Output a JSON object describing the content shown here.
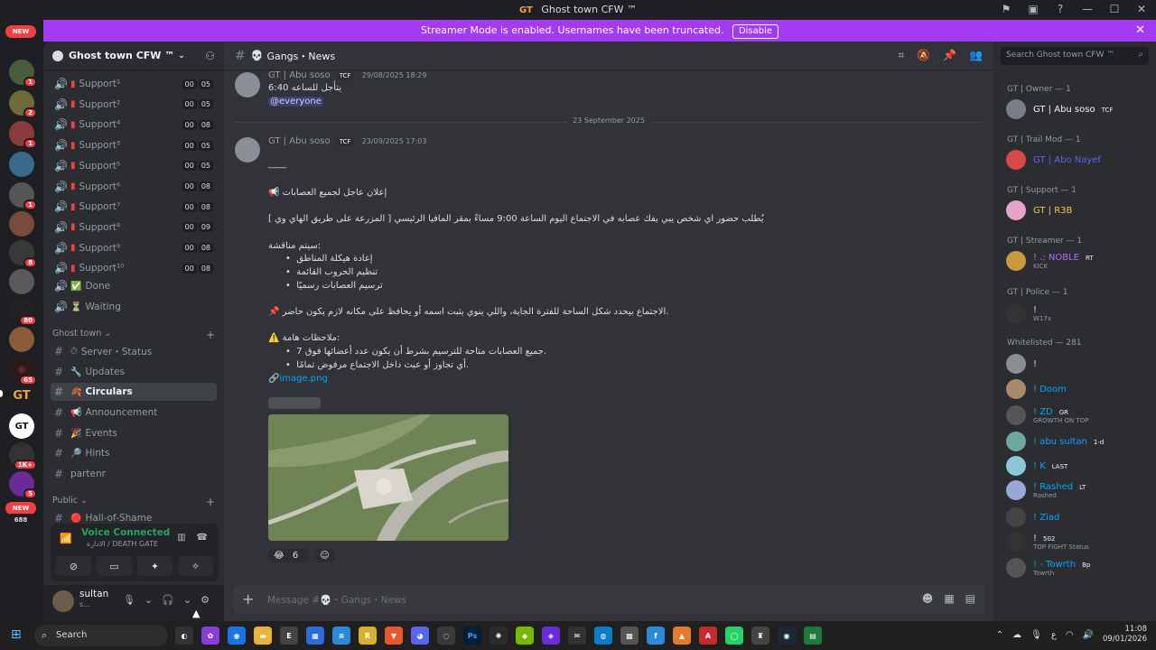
{
  "window": {
    "app_badge": "GT",
    "title": "Ghost town CFW ™",
    "minimize": "—",
    "maximize": "☐",
    "close": "✕"
  },
  "banner": {
    "text": "Streamer Mode is enabled. Usernames have been truncated.",
    "button": "Disable"
  },
  "server_rail": {
    "badges": [
      "1",
      "1",
      "2",
      "1",
      "1",
      "1",
      "8",
      "80",
      "65",
      "1K+",
      "5",
      "688"
    ],
    "new_label": "NEW"
  },
  "sidebar": {
    "guild_name": "Ghost town CFW ™",
    "channels": [
      {
        "name": "Support¹",
        "a": "00",
        "b": "05"
      },
      {
        "name": "Support²",
        "a": "00",
        "b": "05"
      },
      {
        "name": "Support⁴",
        "a": "00",
        "b": "08"
      },
      {
        "name": "Support³",
        "a": "00",
        "b": "05"
      },
      {
        "name": "Support⁵",
        "a": "00",
        "b": "05"
      },
      {
        "name": "Support⁶",
        "a": "00",
        "b": "08"
      },
      {
        "name": "Support⁷",
        "a": "00",
        "b": "08"
      },
      {
        "name": "Support⁸",
        "a": "00",
        "b": "09"
      },
      {
        "name": "Support⁹",
        "a": "00",
        "b": "08"
      },
      {
        "name": "Support¹⁰",
        "a": "00",
        "b": "08"
      }
    ],
    "done": "Done",
    "waiting": "Waiting",
    "cat_ghost": "Ghost town",
    "server_status": "Server・Status",
    "updates": "Updates",
    "circulars": "Circulars",
    "announcement": "Announcement",
    "events": "Events",
    "hints": "Hints",
    "partner": "partenr",
    "cat_public": "Public",
    "hall": "Hall-of-Shame"
  },
  "voice": {
    "status": "Voice Connected",
    "channel": "الادارة / DEATH GATE"
  },
  "user": {
    "name": "sultan",
    "status": "s..."
  },
  "channel_header": {
    "name": "Gangs・News"
  },
  "messages": {
    "m1_author": "GT | Abu soso",
    "m1_tag": "TCF",
    "m1_time": "29/08/2025 18:29",
    "m1_line1": "يتأجل للساعه 6:40",
    "m1_mention": "@everyone",
    "date_divider": "23 September 2025",
    "m2_author": "GT | Abu soso",
    "m2_tag": "TCF",
    "m2_time": "23/09/2025 17:03",
    "l_sep": "____",
    "l1": "📢 إعلان عاجل لجميع العصابات",
    "l2": "يُطلب حضور اي شخص يبي يفك عصابه في الاجتماع اليوم الساعة 9:00 مساءً بمقر المافيا الرئيسي [ المزرعة على طريق الهاي وي ]",
    "l3": "سيتم مناقشة:",
    "b1": "إعادة هيكلة المناطق",
    "b2": "تنظيم الحروب القائمة",
    "b3": "ترسيم العصابات رسميًا",
    "l4": "📌 الاجتماع بيحدد شكل الساحة للفترة الجاية، واللي ينوي يثبت اسمه أو يحافظ على مكانه لازم يكون حاضر.",
    "l5": "⚠️ ملاحظات هامة:",
    "b4": "جميع العصابات متاحة للترسيم بشرط أن يكون عدد أعضائها فوق 7.",
    "b5": "أي تجاوز أو عبث داخل الاجتماع مرفوض تمامًا.",
    "attachment": "image.png",
    "reaction_count": "6"
  },
  "composer": {
    "placeholder": "Message #💀・Gangs・News"
  },
  "members": {
    "search_placeholder": "Search Ghost town CFW ™",
    "groups": {
      "owner": "GT | Owner — 1",
      "trail": "GT | Trail Mod — 1",
      "support": "GT | Support — 1",
      "streamer": "GT | Streamer — 1",
      "police": "GT | Police — 1",
      "white": "Whitelisted — 281"
    },
    "list": [
      {
        "name": "GT | Abu soso",
        "sub": "",
        "tag": "TCF",
        "color": "#f2f3f5"
      },
      {
        "name": "GT | Abo Nayef",
        "sub": "",
        "tag": "",
        "color": "#5865f2"
      },
      {
        "name": "GT | R3B",
        "sub": "",
        "tag": "",
        "color": "#f2c94c"
      },
      {
        "name": "! .: NOBLE",
        "sub": "KICK",
        "tag": "RT",
        "color": "#a970ff"
      },
      {
        "name": "!",
        "sub": "W17x",
        "tag": "",
        "color": "#dbdee1"
      },
      {
        "name": "!",
        "sub": "",
        "tag": "",
        "color": "#dbdee1"
      },
      {
        "name": "! Doom",
        "sub": "",
        "tag": "",
        "color": "#00a8fc"
      },
      {
        "name": "! ZD",
        "sub": "GROWTH ON TOP",
        "tag": "GR",
        "color": "#00a8fc"
      },
      {
        "name": "! abu sultan",
        "sub": "",
        "tag": "1-d",
        "color": "#00a8fc"
      },
      {
        "name": "! K",
        "sub": "",
        "tag": "LAST",
        "color": "#00a8fc"
      },
      {
        "name": "! Rashed",
        "sub": "Rashed",
        "tag": "LT",
        "color": "#00a8fc"
      },
      {
        "name": "! Ziad",
        "sub": "",
        "tag": "",
        "color": "#00a8fc"
      },
      {
        "name": "!",
        "sub": "TOP FIGHT Status",
        "tag": "502",
        "color": "#dbdee1"
      },
      {
        "name": "! - Towrth",
        "sub": "Towrth",
        "tag": "Bp",
        "color": "#00a8fc"
      }
    ]
  },
  "taskbar": {
    "search": "Search",
    "time": "11:08",
    "date": "09/01/2026",
    "lang": "ع"
  }
}
